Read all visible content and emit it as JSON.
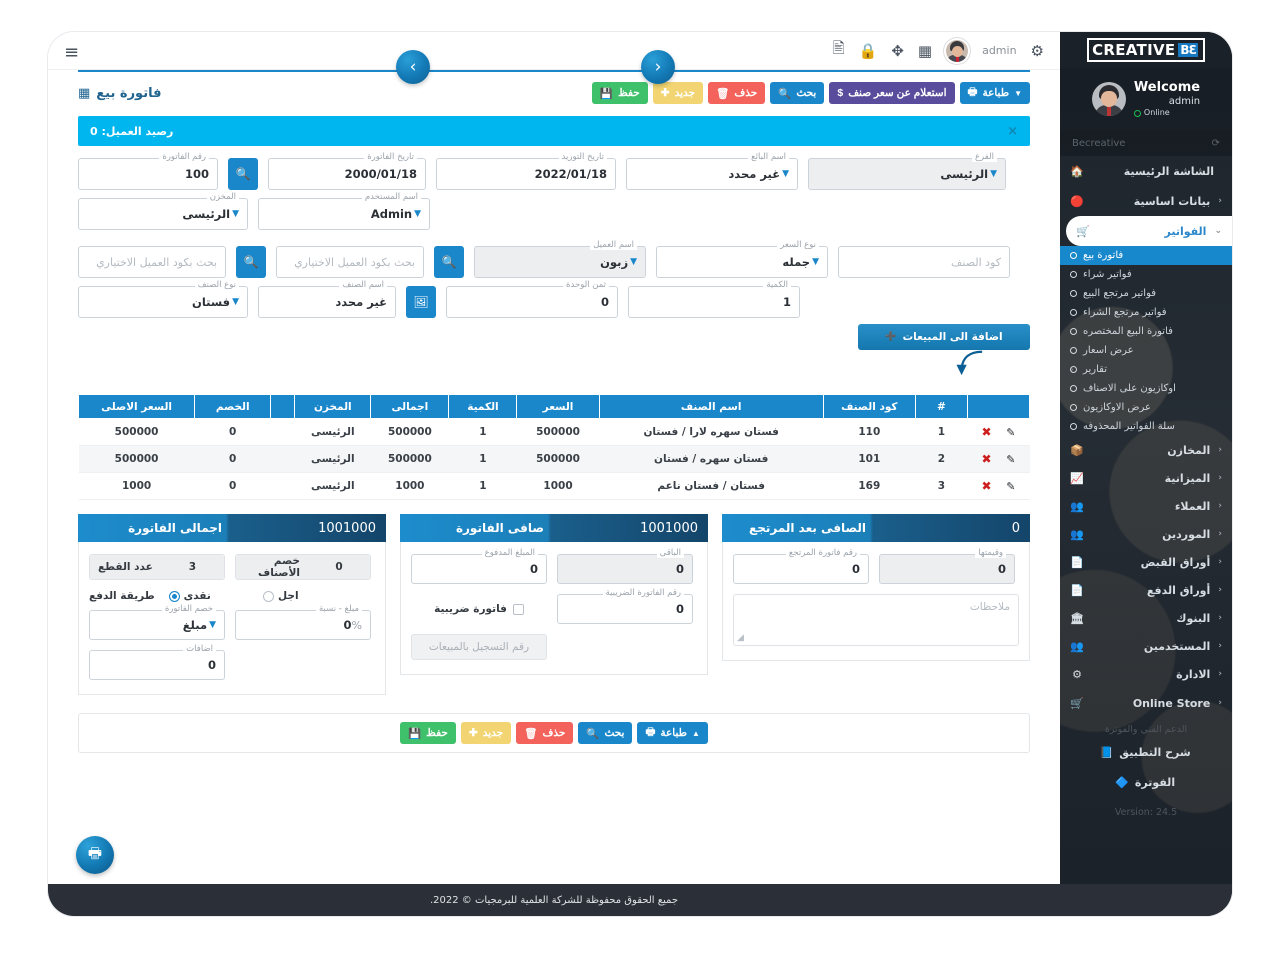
{
  "topbar": {
    "user_label": "admin",
    "icons": [
      "gear-icon",
      "avatar",
      "grid-apps-icon",
      "fullscreen-icon",
      "lock-icon",
      "id-card-icon"
    ],
    "hamburger": "≡",
    "nav_prev": "‹",
    "nav_next": "›"
  },
  "page": {
    "title": "فاتورة بيع",
    "title_icon": "▦"
  },
  "toolbar": {
    "save": "حفظ",
    "new": "جديد",
    "delete": "حذف",
    "search": "بحث",
    "inquiry": "استعلام عن سعر صنف",
    "print": "طباعة"
  },
  "client_bar": {
    "text": "رصيد العميل: 0",
    "close": "×"
  },
  "fields": {
    "invoice_no": {
      "label": "رقم الفاتورة",
      "value": "100"
    },
    "invoice_date": {
      "label": "تاريخ الفاتورة",
      "value": "2000/01/18"
    },
    "supply_date": {
      "label": "تاريخ التوريد",
      "value": "2022/01/18"
    },
    "seller_name": {
      "label": "اسم البائع",
      "value": "غير محدد"
    },
    "branch": {
      "label": "الفرع",
      "value": "الرئيسى"
    },
    "store": {
      "label": "المخزن",
      "value": "الرئيسى"
    },
    "user_name": {
      "label": "اسم المستخدم",
      "value": "Admin"
    },
    "client_code_search": {
      "placeholder": "بحث بكود العميل الاختياري"
    },
    "client_code_search2": {
      "placeholder": "بحث بكود العميل الاختياري"
    },
    "client_name": {
      "label": "اسم العميل",
      "value": "زبون"
    },
    "price_type": {
      "label": "نوع السعر",
      "value": "جمله"
    },
    "item_code": {
      "placeholder": "كود الصنف"
    },
    "item_type": {
      "label": "نوع الصنف",
      "value": "فستان"
    },
    "item_name": {
      "label": "اسم الصنف",
      "value": "غير محدد"
    },
    "unit_price": {
      "label": "ثمن الوحدة",
      "value": "0"
    },
    "quantity": {
      "label": "الكمية",
      "value": "1"
    }
  },
  "add_button": {
    "label": "اضافة الى المبيعات",
    "icon": "➕"
  },
  "items_table": {
    "headers": [
      "",
      "#",
      "كود الصنف",
      "اسم الصنف",
      "السعر",
      "الكمية",
      "اجمالى",
      "المخزن",
      "",
      "الخصم",
      "السعر الاصلى"
    ],
    "rows": [
      {
        "idx": "1",
        "code": "110",
        "name": "فستان سهره لارا / فستان",
        "price": "500000",
        "qty": "1",
        "total": "500000",
        "store": "الرئيسى",
        "blank": "",
        "discount": "0",
        "orig_price": "500000"
      },
      {
        "idx": "2",
        "code": "101",
        "name": "فستان سهره / فستان",
        "price": "500000",
        "qty": "1",
        "total": "500000",
        "store": "الرئيسى",
        "blank": "",
        "discount": "0",
        "orig_price": "500000"
      },
      {
        "idx": "3",
        "code": "169",
        "name": "فستان / فستان ناعم",
        "price": "1000",
        "qty": "1",
        "total": "1000",
        "store": "الرئيسى",
        "blank": "",
        "discount": "0",
        "orig_price": "1000"
      }
    ]
  },
  "panel_total": {
    "title": "اجمالى الفاتورة",
    "value": "1001000",
    "pieces_label": "عدد القطع",
    "pieces_value": "3",
    "items_discount_label": "خصم الأصناف",
    "items_discount_value": "0",
    "payment_label": "طريقة الدفع",
    "payment_cash": "نقدى",
    "payment_credit": "اجل",
    "invoice_discount_label": "خصم الفاتورة",
    "invoice_discount_value": "مبلغ",
    "amount_pct_label": "مبلغ - نسبة",
    "amount_pct_value": "0",
    "pct_sign": "%",
    "additions_label": "اضافات",
    "additions_value": "0"
  },
  "panel_net": {
    "title": "صافى الفاتورة",
    "value": "1001000",
    "paid_label": "المبلغ المدفوع",
    "paid_value": "0",
    "remaining_label": "الباقى",
    "remaining_value": "0",
    "tax_invoice_label": "فاتورة ضريبية",
    "tax_invoice_no_label": "رقم الفاتورة الضريبية",
    "tax_invoice_no_value": "0",
    "sales_reg_no": "رقم التسجيل بالمبيعات"
  },
  "panel_return": {
    "title": "الصافى بعد المرتجع",
    "value": "0",
    "return_no_label": "رقم فاتورة المرتجع",
    "return_no_value": "0",
    "return_amount_label": "وقيمتها",
    "return_amount_value": "0",
    "notes_placeholder": "ملاحظات"
  },
  "footer": {
    "text": "جميع الحقوق محفوظة للشركة العلمية للبرمجيات © 2022."
  },
  "sidebar": {
    "logo_be": "BƐ",
    "logo_word": "CREATIVE",
    "welcome": "Welcome",
    "user": "admin",
    "status": "Online",
    "brand": "Becreative",
    "refresh_icon": "⟳",
    "items": [
      {
        "label": "الشاشة الرئيسية",
        "icon": "🏠",
        "caret": ""
      },
      {
        "label": "بيانات اساسية",
        "icon": "🔴",
        "caret": "‹"
      },
      {
        "label": "الفواتير",
        "icon": "🛒",
        "caret": "⌄"
      }
    ],
    "invoice_subitems": [
      {
        "label": "فاتورة بيع",
        "active": true,
        "caret": ""
      },
      {
        "label": "فواتير شراء",
        "active": false,
        "caret": ""
      },
      {
        "label": "فواتير مرتجع البيع",
        "active": false,
        "caret": ""
      },
      {
        "label": "فواتير مرتجع الشراء",
        "active": false,
        "caret": ""
      },
      {
        "label": "فاتورة البيع المختصره",
        "active": false,
        "caret": ""
      },
      {
        "label": "عرض اسعار",
        "active": false,
        "caret": ""
      },
      {
        "label": "تقارير",
        "active": false,
        "caret": "‹"
      },
      {
        "label": "اوكازيون على الاصناف",
        "active": false,
        "caret": ""
      },
      {
        "label": "عرض الاوكازيون",
        "active": false,
        "caret": ""
      },
      {
        "label": "سلة الفواتير المحذوفه",
        "active": false,
        "caret": ""
      }
    ],
    "items2": [
      {
        "label": "المخازن",
        "icon": "📦",
        "caret": "‹"
      },
      {
        "label": "الميزانية",
        "icon": "📈",
        "caret": "‹"
      },
      {
        "label": "العملاء",
        "icon": "👥",
        "caret": "‹"
      },
      {
        "label": "الموردين",
        "icon": "👥",
        "caret": "‹"
      },
      {
        "label": "أوراق القبض",
        "icon": "📄",
        "caret": "‹"
      },
      {
        "label": "أوراق الدفع",
        "icon": "📄",
        "caret": "‹"
      },
      {
        "label": "البنوك",
        "icon": "🏛",
        "caret": "‹"
      },
      {
        "label": "المستخدمين",
        "icon": "👥",
        "caret": "‹"
      },
      {
        "label": "الادارة",
        "icon": "⚙",
        "caret": "‹"
      },
      {
        "label": "Online Store",
        "icon": "🛒",
        "caret": "‹"
      }
    ],
    "support_title": "الدعم الفني والفوترة",
    "items3": [
      {
        "label": "شرح التطبيق",
        "icon": "📘",
        "caret": ""
      },
      {
        "label": "الفوترة",
        "icon": "🔷",
        "caret": ""
      }
    ],
    "version": "Version: 24.5"
  },
  "colors": {
    "primary": "#1b87cb",
    "cyan": "#00b6ef",
    "green": "#3fc06a",
    "yellow": "#f2d572",
    "red": "#f3635c",
    "purple": "#5a4c9c",
    "dark": "#2b3038"
  }
}
